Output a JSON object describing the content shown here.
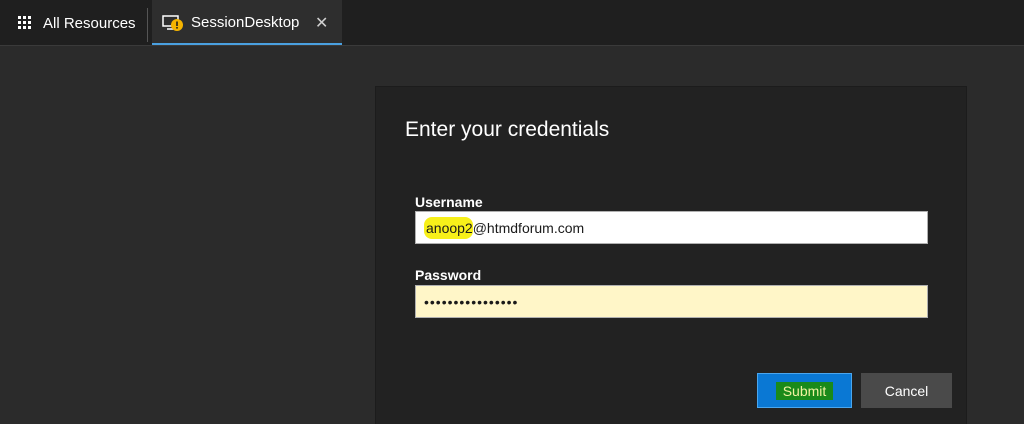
{
  "topbar": {
    "all_resources_label": "All Resources",
    "tab": {
      "label": "SessionDesktop",
      "close_glyph": "✕"
    }
  },
  "dialog": {
    "title": "Enter your credentials",
    "username_label": "Username",
    "username_value_highlighted": "anoop2",
    "username_value_rest": "@htmdforum.com",
    "password_label": "Password",
    "password_value": "••••••••••••••••",
    "submit_label": "Submit",
    "cancel_label": "Cancel"
  },
  "colors": {
    "accent": "#0a78d4",
    "password_field_bg": "#fff6c8",
    "highlight": "#f7f01a"
  },
  "icons": {
    "all_resources": "grid-icon",
    "tab": "monitor-warning-icon",
    "close": "close-icon"
  }
}
